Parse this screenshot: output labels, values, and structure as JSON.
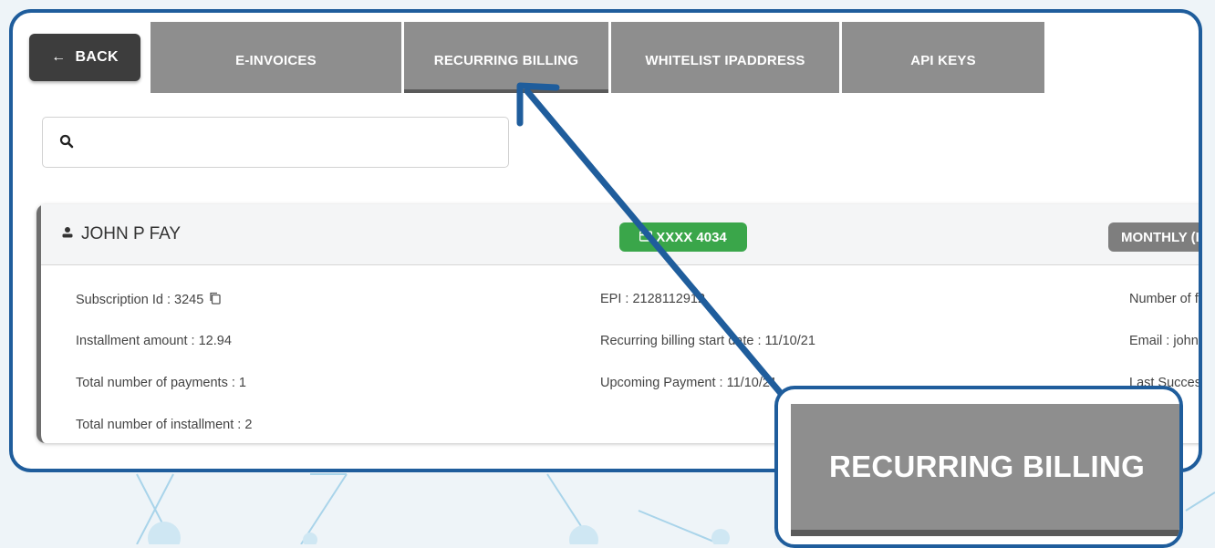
{
  "nav": {
    "back_label": "BACK",
    "back_arrow": "←",
    "tabs": [
      "E-INVOICES",
      "RECURRING BILLING",
      "WHITELIST IPADDRESS",
      "API KEYS"
    ],
    "active_tab": "RECURRING BILLING"
  },
  "search": {
    "value": "",
    "placeholder": ""
  },
  "subscription": {
    "customer_name": "JOHN P FAY",
    "card_label": "XXXX 4034",
    "frequency_label": "MONTHLY (I",
    "fields": {
      "subscription_id": "Subscription Id : 3245",
      "installment_amount": "Installment amount : 12.94",
      "total_payments": "Total number of payments : 1",
      "total_installment": "Total number of installment : 2",
      "epi": "EPI : 2128112912",
      "start_date": "Recurring billing start date : 11/10/21",
      "upcoming_payment": "Upcoming Payment : 11/10/21",
      "number_of": "Number of f",
      "email": "Email : john",
      "last_success": "Last Succes"
    }
  },
  "callout": {
    "label": "RECURRING BILLING"
  },
  "colors": {
    "frame": "#1f5d9c",
    "tab_bg": "#8e8e8e",
    "back_bg": "#3d3d3d",
    "card_badge": "#3aa64a",
    "freq_badge": "#7e7e7e"
  },
  "icons": [
    "back-arrow-icon",
    "search-icon",
    "user-icon",
    "copy-icon",
    "credit-card-icon"
  ]
}
